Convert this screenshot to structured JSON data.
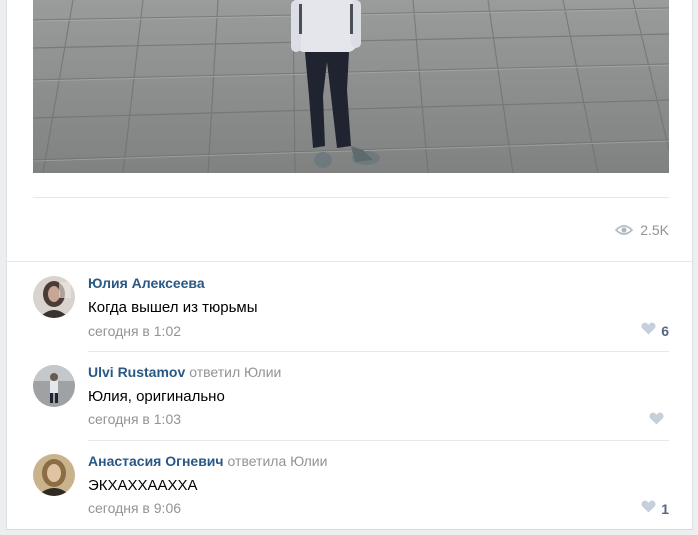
{
  "post": {
    "views": "2.5K",
    "icons": {
      "views": "eye-icon",
      "like": "heart-icon"
    }
  },
  "comments": [
    {
      "author": "Юлия Алексеева",
      "reply_to": "",
      "text": "Когда вышел из тюрьмы",
      "time": "сегодня в 1:02",
      "likes": "6"
    },
    {
      "author": "Ulvi Rustamov",
      "reply_to": "ответил Юлии",
      "text": "Юлия, оригинально",
      "time": "сегодня в 1:03",
      "likes": ""
    },
    {
      "author": "Анастасия Огневич",
      "reply_to": "ответила Юлии",
      "text": "ЭКХАХХААХХА",
      "time": "сегодня в 9:06",
      "likes": "1"
    }
  ],
  "colors": {
    "link": "#2a5885",
    "meta": "#939393",
    "like_icon": "#c5d0db",
    "like_count": "#55677d"
  }
}
